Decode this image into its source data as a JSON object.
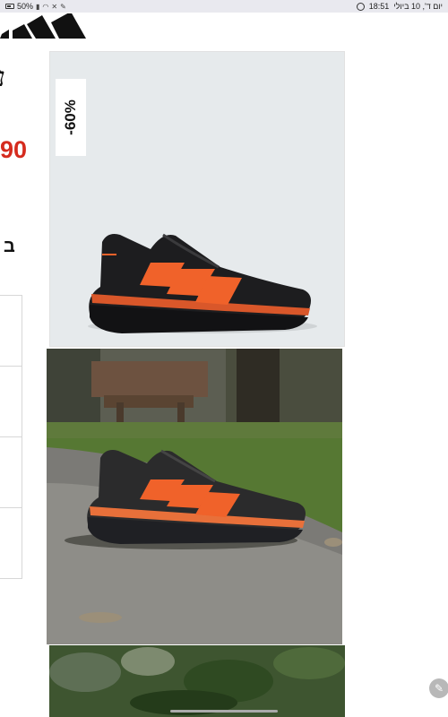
{
  "status_bar": {
    "battery": "50%",
    "time": "18:51",
    "date": "יום ד', 10 ביולי"
  },
  "product": {
    "title_fragment": "נ",
    "price_fragment": "90",
    "subtitle_fragment": "ב",
    "discount_badge": "-60%"
  },
  "icons": {
    "logo": "adidas-logo",
    "edit": "pencil-icon",
    "chat": "whatsapp-icon"
  },
  "colors": {
    "price": "#d52b1e",
    "shoe_body": "#1d1d1f",
    "shoe_stripes": "#f0622a"
  }
}
